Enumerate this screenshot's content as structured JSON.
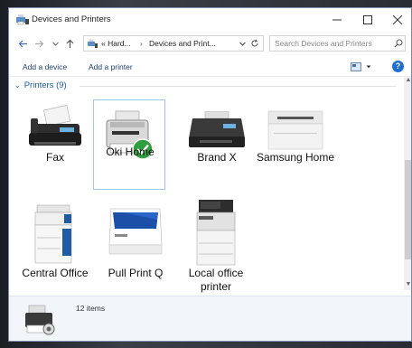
{
  "window": {
    "title": "Devices and Printers"
  },
  "address": {
    "crumbs": [
      "« Hard...",
      "Devices and Print..."
    ],
    "search_placeholder": "Search Devices and Printers"
  },
  "commands": {
    "add_device": "Add a device",
    "add_printer": "Add a printer"
  },
  "group": {
    "label": "Printers (9)"
  },
  "devices": [
    {
      "name": "Fax",
      "icon": "fax-icon"
    },
    {
      "name": "Oki Home",
      "icon": "printer-default-icon"
    },
    {
      "name": "Brand X",
      "icon": "printer-icon"
    },
    {
      "name": "Samsung Home",
      "icon": "laser-printer-icon"
    },
    {
      "name": "Central Office",
      "icon": "copier-icon"
    },
    {
      "name": "Pull Print Q",
      "icon": "printer-icon"
    },
    {
      "name": "Local office printer",
      "icon": "mfp-printer-icon"
    }
  ],
  "details": {
    "count": "12 items"
  },
  "colors": {
    "link": "#1e3f6e",
    "group": "#1e5aa6",
    "selection": "#99c9ef",
    "default_check": "#2e9e3e"
  }
}
